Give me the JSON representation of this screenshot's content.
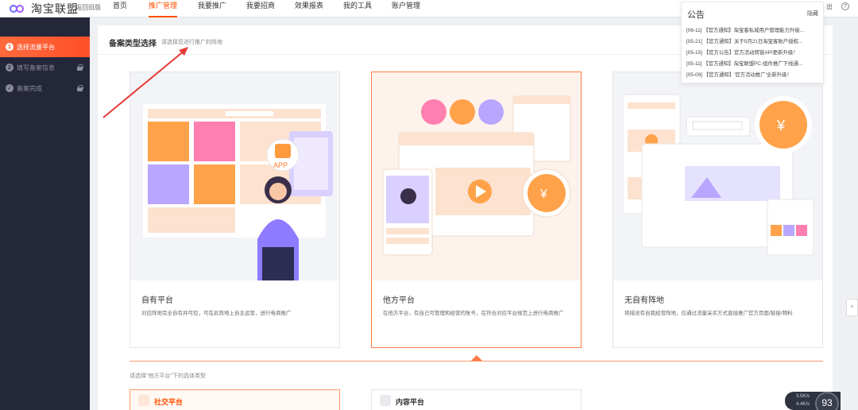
{
  "topbar": {
    "logo_text": "淘宝联盟",
    "back_old": "返回旧版",
    "nav": [
      "首页",
      "推广管理",
      "我要推广",
      "我要招商",
      "效果报表",
      "我的工具",
      "账户管理"
    ],
    "active_nav": "推广管理",
    "right_fragment": "出",
    "help_icon": "?"
  },
  "sidebar": {
    "steps": [
      {
        "num": "1",
        "label": "选择流量平台"
      },
      {
        "num": "2",
        "label": "填写备案信息"
      },
      {
        "num": "",
        "label": "备案完成"
      }
    ]
  },
  "main": {
    "title": "备案类型选择",
    "hint": "请选择您进行推广的阵地",
    "cards": [
      {
        "title": "自有平台",
        "desc": "对应阵地完全自有并可控，可在此阵地上自主运营，进行电商推广",
        "app_label": "APP"
      },
      {
        "title": "他方平台",
        "desc": "在他方平台，有自己可管理和经营的账号，在符合对应平台规范上进行电商推广"
      },
      {
        "title": "无自有阵地",
        "desc": "将描没有自我经营阵地，仅通过流量采买方式直接推广官方页面/链接/物料"
      }
    ],
    "selected_card": 1,
    "sub_hint": "请选择\"他方平台\"下的具体类型",
    "sub_cards": [
      {
        "title": "社交平台"
      },
      {
        "title": "内容平台"
      }
    ]
  },
  "notice": {
    "title": "公告",
    "hide_label": "隐藏",
    "items": [
      "[06-11] 【官方通知】淘宝客私域用户管理能力升级...",
      "[05-21] 【官方通知】关于5月21日淘宝客账户授权...",
      "[05-15] 【官方公告】官方活动转链API更新升级！",
      "[05-11] 【官方通知】淘宝联盟PC-组件推广下线通...",
      "[05-09] 【官方通知】'官方活动推广'全新升级！"
    ]
  },
  "widget": {
    "up_speed": "3.5K/s",
    "down_speed": "4.4K/s",
    "percent": "93"
  },
  "colors": {
    "accent": "#ff5000",
    "sidebar_bg": "#24263a"
  }
}
